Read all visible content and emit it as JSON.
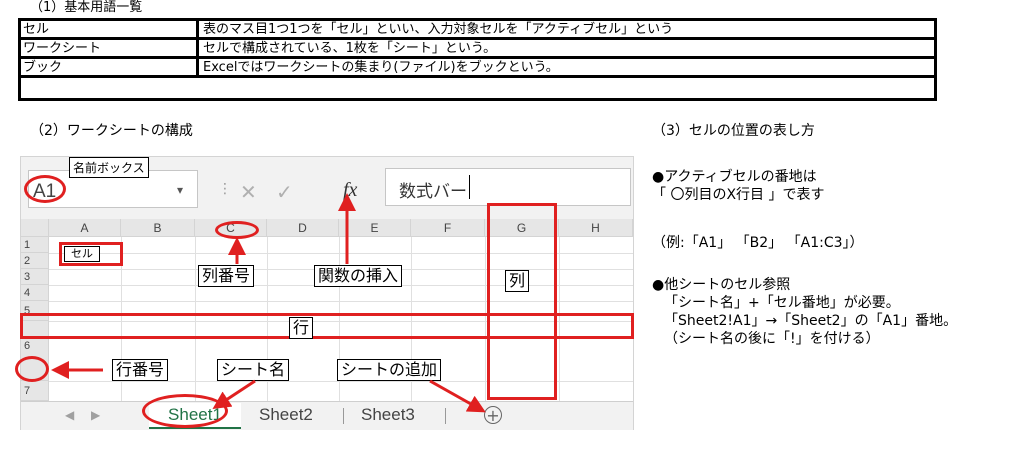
{
  "section1": {
    "title": "（1）基本用語一覧",
    "rows": [
      {
        "term": "セル",
        "desc": "表のマス目1つ1つを「セル」といい、入力対象セルを「アクティブセル」という"
      },
      {
        "term": "ワークシート",
        "desc": "セルで構成されている、1枚を「シート」という。"
      },
      {
        "term": "ブック",
        "desc": "Excelではワークシートの集まり(ファイル)をブックという。"
      }
    ]
  },
  "section2": {
    "title": "（2）ワークシートの構成",
    "excel": {
      "name_box_value": "A1",
      "name_box_label": "名前ボックス",
      "fx_cancel": "✕",
      "fx_enter": "✓",
      "fx_symbol": "fx",
      "formula_bar_label": "数式バー",
      "columns": [
        "A",
        "B",
        "C",
        "D",
        "E",
        "F",
        "G",
        "H"
      ],
      "rows": [
        "1",
        "2",
        "3",
        "4",
        "5",
        "6",
        "7"
      ],
      "cell_a1_label": "セル",
      "tabs": [
        "Sheet1",
        "Sheet2",
        "Sheet3"
      ],
      "add_sheet_icon": "+"
    },
    "annotations": {
      "column_number": "列番号",
      "insert_function": "関数の挿入",
      "column": "列",
      "row": "行",
      "row_number": "行番号",
      "sheet_name": "シート名",
      "add_sheet": "シートの追加"
    },
    "highlight_color": "#e02020"
  },
  "section3": {
    "title": "（3）セルの位置の表し方",
    "lines": [
      "●アクティブセルの番地は",
      "「 〇列目のX行目 」で表す",
      "（例:「A1」 「B2」 「A1:C3」）",
      "●他シートのセル参照",
      "「シート名」+「セル番地」が必要。",
      "「Sheet2!A1」→「Sheet2」の「A1」番地。",
      "（シート名の後に「!」を付ける）"
    ]
  }
}
